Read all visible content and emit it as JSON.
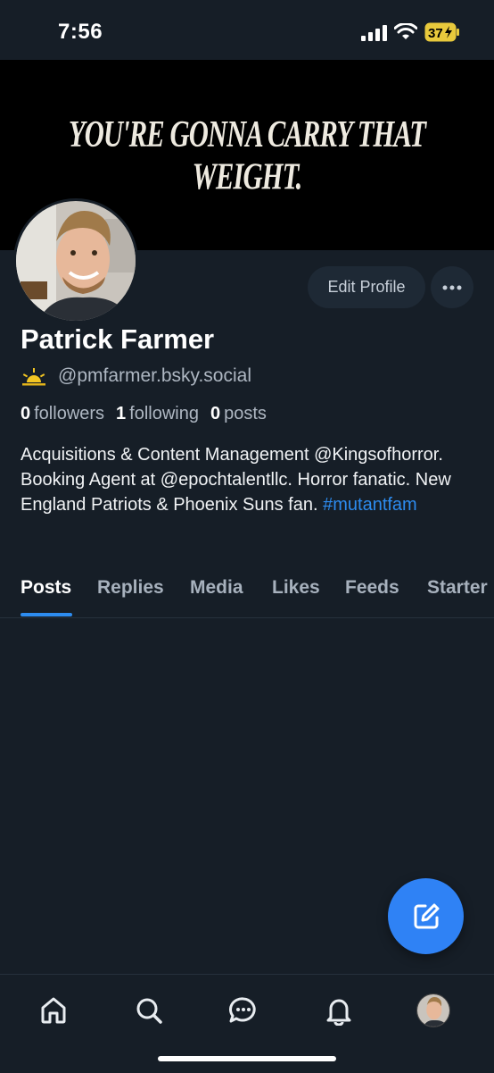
{
  "status_bar": {
    "time": "7:56",
    "battery": "37"
  },
  "banner": {
    "text": "YOU'RE GONNA CARRY THAT WEIGHT."
  },
  "profile": {
    "name": "Patrick Farmer",
    "handle": "@pmfarmer.bsky.social",
    "edit_label": "Edit Profile",
    "followers_count": "0",
    "followers_label": "followers",
    "following_count": "1",
    "following_label": "following",
    "posts_count": "0",
    "posts_label": "posts",
    "bio_text": "Acquisitions & Content Management @Kingsofhorror. Booking Agent at @epochtalentllc. Horror fanatic. New England Patriots & Phoenix Suns fan. ",
    "bio_hashtag": "#mutantfam"
  },
  "tabs": [
    {
      "label": "Posts",
      "active": true
    },
    {
      "label": "Replies"
    },
    {
      "label": "Media"
    },
    {
      "label": "Likes"
    },
    {
      "label": "Feeds"
    },
    {
      "label": "Starter"
    }
  ],
  "bottom_nav": [
    "home-icon",
    "search-icon",
    "chat-icon",
    "bell-icon",
    "profile-avatar"
  ],
  "colors": {
    "accent": "#2d8cf0",
    "background": "#161e27",
    "button_bg": "#1e2935"
  }
}
